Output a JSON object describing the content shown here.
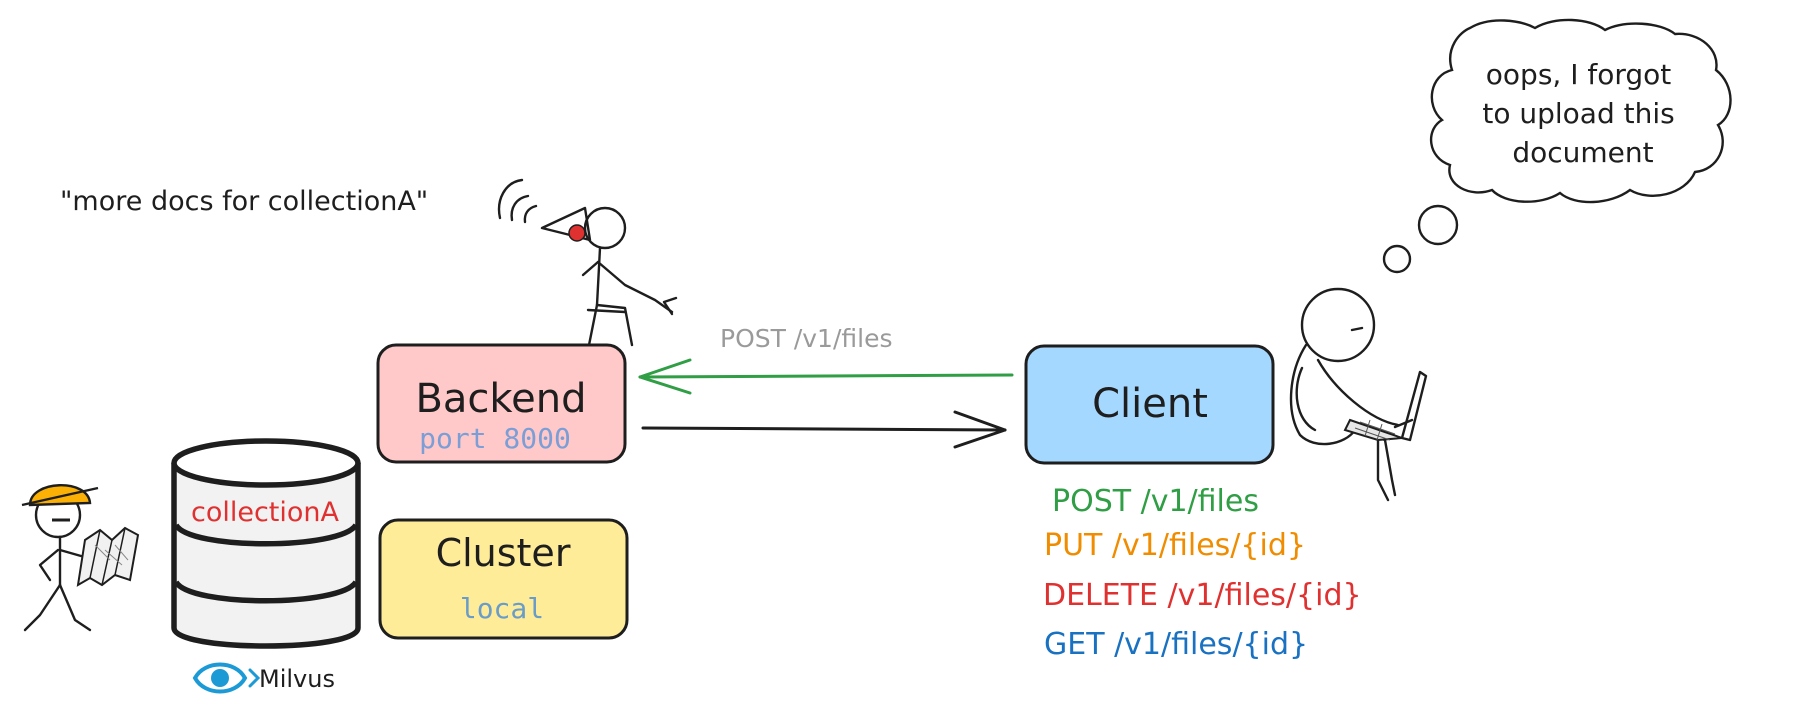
{
  "quote": "\"more docs for collectionA\"",
  "thought": {
    "lines": [
      "oops, I forgot",
      "to upload this",
      "document"
    ]
  },
  "backend": {
    "label": "Backend",
    "port": "port 8000"
  },
  "cluster": {
    "label": "Cluster",
    "value": "local"
  },
  "client": {
    "label": "Client"
  },
  "arrow_label": "POST /v1/files",
  "database": {
    "collection": "collectionA",
    "brand": "Milvus"
  },
  "endpoints": {
    "post": "POST /v1/files",
    "put": "PUT /v1/files/{id}",
    "delete": "DELETE /v1/files/{id}",
    "get": "GET /v1/files/{id}"
  },
  "colors": {
    "backend_fill": "#ffc9c9",
    "cluster_fill": "#ffec99",
    "client_fill": "#a5d8ff",
    "post": "#2f9e44",
    "put": "#f08c00",
    "delete": "#e03131",
    "get": "#1971c2",
    "port_text": "#7c9ed6",
    "local_text": "#6a9cc8",
    "collection_text": "#e03131",
    "milvus_blue": "#1c9ad6",
    "helmet": "#fab005"
  }
}
